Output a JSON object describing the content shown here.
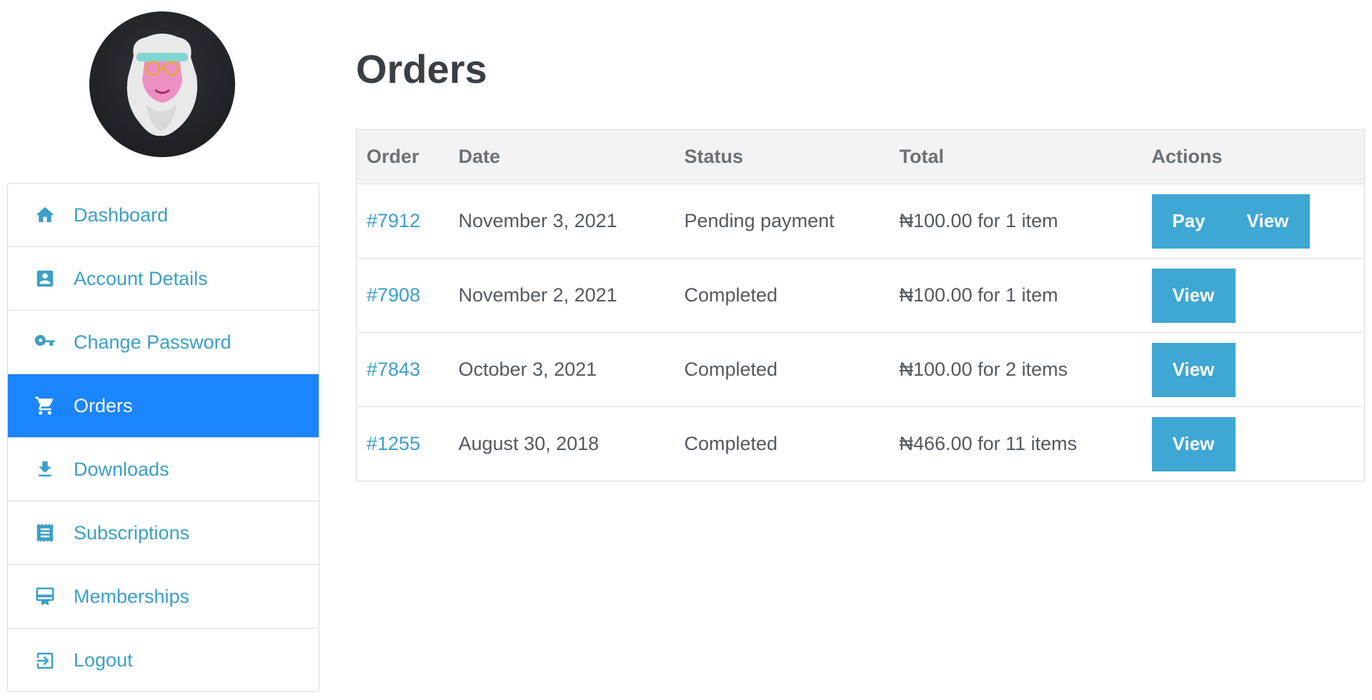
{
  "avatar": {
    "alt": "user avatar"
  },
  "sidebar": {
    "items": [
      {
        "label": "Dashboard",
        "icon": "home-icon",
        "active": false
      },
      {
        "label": "Account Details",
        "icon": "account-box-icon",
        "active": false
      },
      {
        "label": "Change Password",
        "icon": "key-icon",
        "active": false
      },
      {
        "label": "Orders",
        "icon": "cart-icon",
        "active": true
      },
      {
        "label": "Downloads",
        "icon": "download-icon",
        "active": false
      },
      {
        "label": "Subscriptions",
        "icon": "receipt-icon",
        "active": false
      },
      {
        "label": "Memberships",
        "icon": "membership-card-icon",
        "active": false
      },
      {
        "label": "Logout",
        "icon": "logout-icon",
        "active": false
      }
    ]
  },
  "main": {
    "title": "Orders",
    "table": {
      "headers": [
        "Order",
        "Date",
        "Status",
        "Total",
        "Actions"
      ],
      "rows": [
        {
          "order": "#7912",
          "date": "November 3, 2021",
          "status": "Pending payment",
          "total": "₦100.00 for 1 item",
          "actions": [
            "Pay",
            "View"
          ]
        },
        {
          "order": "#7908",
          "date": "November 2, 2021",
          "status": "Completed",
          "total": "₦100.00 for 1 item",
          "actions": [
            "View"
          ]
        },
        {
          "order": "#7843",
          "date": "October 3, 2021",
          "status": "Completed",
          "total": "₦100.00 for 2 items",
          "actions": [
            "View"
          ]
        },
        {
          "order": "#1255",
          "date": "August 30, 2018",
          "status": "Completed",
          "total": "₦466.00 for 11 items",
          "actions": [
            "View"
          ]
        }
      ]
    }
  },
  "colors": {
    "accent": "#3b9fc9",
    "active_nav": "#1a85ff",
    "button": "#3ea7d3",
    "header_bg": "#f3f3f5",
    "border": "#dcdcdc"
  }
}
